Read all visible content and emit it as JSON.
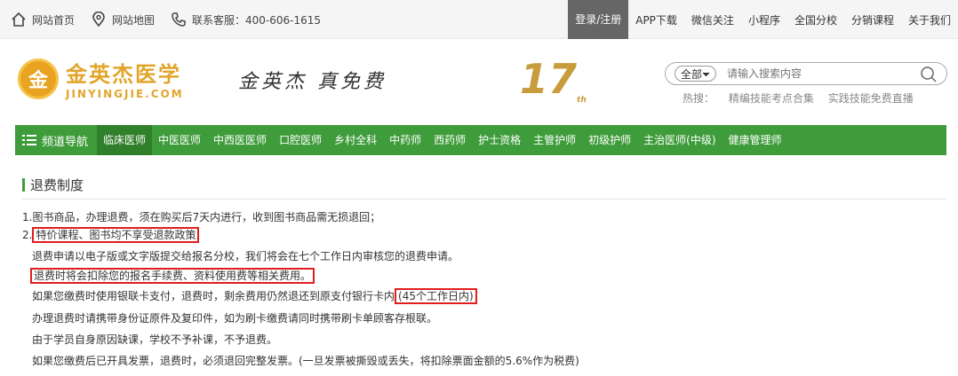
{
  "topbar": {
    "home": "网站首页",
    "sitemap": "网站地图",
    "service": "联系客服：400-606-1615",
    "login": "登录/注册",
    "nav": [
      "APP下载",
      "微信关注",
      "小程序",
      "全国分校",
      "分销课程",
      "关于我们"
    ]
  },
  "header": {
    "logo_cn": "金英杰医学",
    "logo_en": "JINYINGJIE.COM",
    "slogan": "金英杰 真免费",
    "badge": "17",
    "badge_sub": "th"
  },
  "search": {
    "scope": "全部",
    "placeholder": "请输入搜索内容",
    "hot_label": "热搜：",
    "hot_items": [
      "精编技能考点合集",
      "实践技能免费直播"
    ]
  },
  "channel_nav": {
    "head": "频道导航",
    "items": [
      "临床医师",
      "中医医师",
      "中西医医师",
      "口腔医师",
      "乡村全科",
      "中药师",
      "西药师",
      "护士资格",
      "主管护师",
      "初级护师",
      "主治医师(中级)",
      "健康管理师"
    ]
  },
  "content": {
    "title": "退费制度",
    "l1": "1.图书商品，办理退费，须在购买后7天内进行，收到图书商品需无损退回；",
    "l2_prefix": "2.",
    "l2_boxed": "特价课程、图书均不享受退款政策",
    "l3": "退费申请以电子版或文字版提交给报名分校，我们将会在七个工作日内审核您的退费申请。",
    "l4_boxed": "退费时将会扣除您的报名手续费、资料使用费等相关费用。",
    "l5_text": "如果您缴费时使用银联卡支付，退费时，剩余费用仍然退还到原支付银行卡内",
    "l5_boxed": "(45个工作日内)",
    "l6": "办理退费时请携带身份证原件及复印件，如为刷卡缴费请同时携带刷卡单顾客存根联。",
    "l7": "由于学员自身原因缺课，学校不予补课，不予退费。",
    "l8": "如果您缴费后已开具发票，退费时，必须退回完整发票。(一旦发票被撕毁或丢失，将扣除票面金额的5.6%作为税费)"
  }
}
